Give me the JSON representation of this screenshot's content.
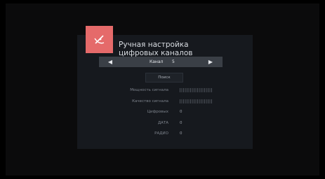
{
  "screen": {
    "title_line1": "Ручная настройка",
    "title_line2": "цифровых каналов",
    "icon": "satellite-dish-icon"
  },
  "channel_selector": {
    "label": "Канал",
    "value": "5",
    "left_arrow": "◀",
    "right_arrow": "▶"
  },
  "search_button": {
    "label": "Поиск"
  },
  "signal": {
    "strength_label": "Мощность сигнала",
    "quality_label": "Качество сигнала"
  },
  "stats": [
    {
      "label": "Цифровых",
      "value": "0"
    },
    {
      "label": "ДАТА",
      "value": "0"
    },
    {
      "label": "РАДИО",
      "value": "0"
    }
  ],
  "colors": {
    "accent": "#e56a6a",
    "panel": "#16191e",
    "selector_bar": "#3a3f46"
  }
}
